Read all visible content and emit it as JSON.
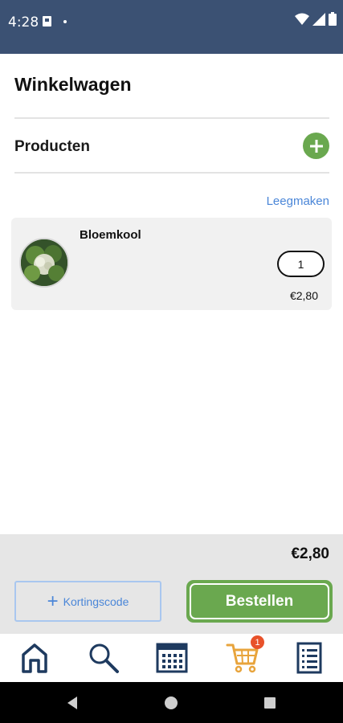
{
  "status_bar": {
    "time": "4:28"
  },
  "header": {
    "title": "Winkelwagen"
  },
  "products_section": {
    "title": "Producten",
    "clear_label": "Leegmaken"
  },
  "cart_items": [
    {
      "name": "Bloemkool",
      "quantity": "1",
      "price": "€2,80"
    }
  ],
  "checkout": {
    "total": "€2,80",
    "discount_label": "Kortingscode",
    "order_label": "Bestellen"
  },
  "bottom_nav": {
    "items": [
      "home-icon",
      "search-icon",
      "calendar-icon",
      "cart-icon",
      "order-list-icon"
    ],
    "cart_badge": "1",
    "active_item": "cart-icon"
  },
  "colors": {
    "status_bar": "#3b5173",
    "accent_green": "#6aa84f",
    "link_blue": "#4a86d8",
    "nav_icon": "#1e3a5f",
    "cart_active": "#e8a43c",
    "badge": "#e8522a"
  }
}
